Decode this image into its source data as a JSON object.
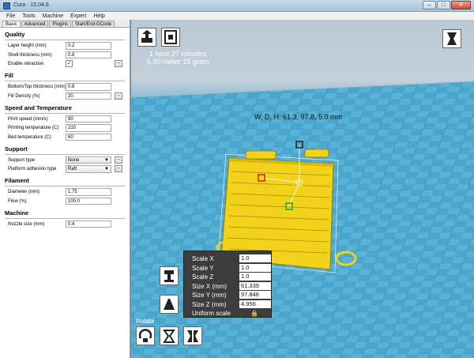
{
  "window": {
    "title": "Cura - 15.04.6"
  },
  "menu": [
    "File",
    "Tools",
    "Machine",
    "Expert",
    "Help"
  ],
  "tabs": [
    "Basic",
    "Advanced",
    "Plugins",
    "Start/End-GCode"
  ],
  "sections": {
    "quality": {
      "title": "Quality",
      "layer_height": {
        "label": "Layer height (mm)",
        "value": "0.2"
      },
      "shell_thickness": {
        "label": "Shell thickness (mm)",
        "value": "0.8"
      },
      "retraction": {
        "label": "Enable retraction",
        "value": "✓"
      }
    },
    "fill": {
      "title": "Fill",
      "bottom_top": {
        "label": "Bottom/Top thickness (mm)",
        "value": "0.8"
      },
      "density": {
        "label": "Fill Density (%)",
        "value": "20"
      }
    },
    "speed": {
      "title": "Speed and Temperature",
      "print_speed": {
        "label": "Print speed (mm/s)",
        "value": "90"
      },
      "print_temp": {
        "label": "Printing temperature (C)",
        "value": "210"
      },
      "bed_temp": {
        "label": "Bed temperature (C)",
        "value": "60"
      }
    },
    "support": {
      "title": "Support",
      "support_type": {
        "label": "Support type",
        "value": "None"
      },
      "adhesion": {
        "label": "Platform adhesion type",
        "value": "Raft"
      }
    },
    "filament": {
      "title": "Filament",
      "diameter": {
        "label": "Diameter (mm)",
        "value": "1.75"
      },
      "flow": {
        "label": "Flow (%)",
        "value": "100.0"
      }
    },
    "machine": {
      "title": "Machine",
      "nozzle": {
        "label": "Nozzle size (mm)",
        "value": "0.4"
      }
    }
  },
  "dots_label": "...",
  "viewport": {
    "print_time": "1 hour 27 minutes",
    "print_material": "6.30 meter 19 gram",
    "dimensions": "W, D, H: 61.3, 97.8, 5.0 mm"
  },
  "scale_panel": {
    "scale_x": {
      "label": "Scale X",
      "value": "1.0"
    },
    "scale_y": {
      "label": "Scale Y",
      "value": "1.0"
    },
    "scale_z": {
      "label": "Scale Z",
      "value": "1.0"
    },
    "size_x": {
      "label": "Size X (mm)",
      "value": "61.339"
    },
    "size_y": {
      "label": "Size Y (mm)",
      "value": "97.846"
    },
    "size_z": {
      "label": "Size Z (mm)",
      "value": "4.956"
    },
    "uniform": {
      "label": "Uniform scale"
    }
  },
  "rotate_label": "Rotate",
  "colors": {
    "model": "#f2d21a",
    "floor": "#4aa2c8",
    "panel": "#3c3c3c"
  }
}
